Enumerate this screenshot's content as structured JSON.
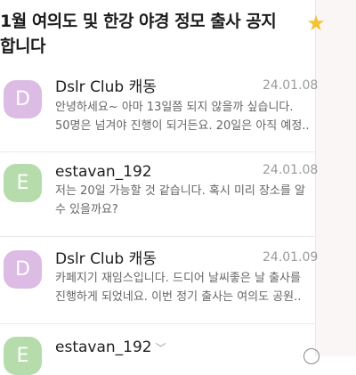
{
  "subject": {
    "line1": "1월 여의도 및 한강 야경 정모 출사 공지",
    "line2": "합니다"
  },
  "colors": {
    "star": "#f2c335",
    "avatar_d": "#dcbbe4",
    "avatar_e": "#b6dcab"
  },
  "messages": [
    {
      "initial": "D",
      "sender": "Dslr Club 캐동",
      "date": "24.01.08",
      "lines": [
        "안녕하세요~ 아마 13일쯤 되지 않을까 싶습니다.",
        "50명은 넘겨야 진행이 되거든요. 20일은 아직 예정.."
      ]
    },
    {
      "initial": "E",
      "sender": "estavan_192",
      "date": "24.01.08",
      "lines": [
        "저는 20일 가능할 것 같습니다. 혹시 미리 장소를 알",
        "수 있을까요?"
      ]
    },
    {
      "initial": "D",
      "sender": "Dslr Club 캐동",
      "date": "24.01.09",
      "lines": [
        "카페지기 재임스입니다. 드디어 날씨좋은 날 출사를",
        "진행하게 되었네요. 이번 정기 출사는 여의도 공원.."
      ]
    },
    {
      "initial": "E",
      "sender": "estavan_192",
      "chevron": "﹀"
    }
  ]
}
